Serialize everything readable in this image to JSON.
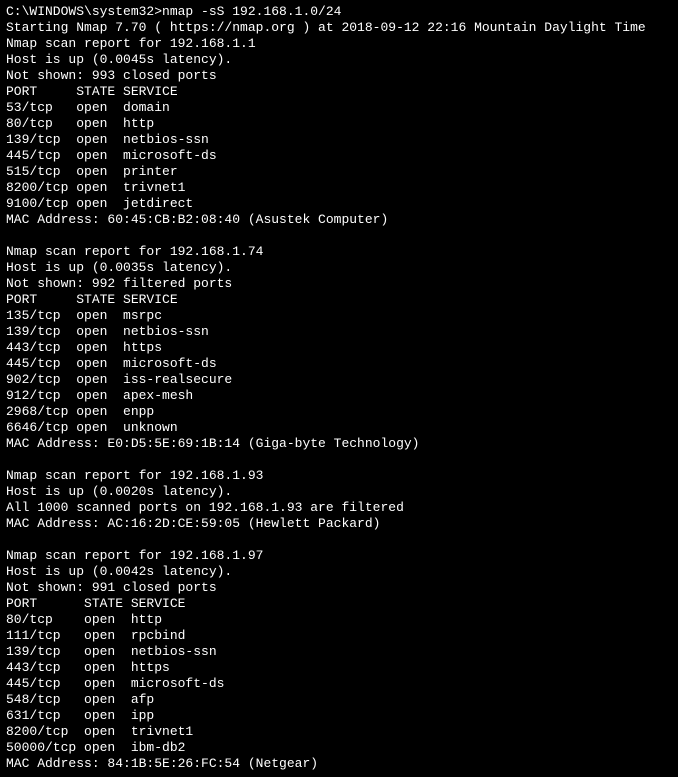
{
  "prompt": "C:\\WINDOWS\\system32>",
  "command": "nmap -sS 192.168.1.0/24",
  "start_line": "Starting Nmap 7.70 ( https://nmap.org ) at 2018-09-12 22:16 Mountain Daylight Time",
  "hosts": [
    {
      "report": "Nmap scan report for 192.168.1.1",
      "status": "Host is up (0.0045s latency).",
      "not_shown": "Not shown: 993 closed ports",
      "header": "PORT     STATE SERVICE",
      "ports": [
        "53/tcp   open  domain",
        "80/tcp   open  http",
        "139/tcp  open  netbios-ssn",
        "445/tcp  open  microsoft-ds",
        "515/tcp  open  printer",
        "8200/tcp open  trivnet1",
        "9100/tcp open  jetdirect"
      ],
      "mac": "MAC Address: 60:45:CB:B2:08:40 (Asustek Computer)"
    },
    {
      "report": "Nmap scan report for 192.168.1.74",
      "status": "Host is up (0.0035s latency).",
      "not_shown": "Not shown: 992 filtered ports",
      "header": "PORT     STATE SERVICE",
      "ports": [
        "135/tcp  open  msrpc",
        "139/tcp  open  netbios-ssn",
        "443/tcp  open  https",
        "445/tcp  open  microsoft-ds",
        "902/tcp  open  iss-realsecure",
        "912/tcp  open  apex-mesh",
        "2968/tcp open  enpp",
        "6646/tcp open  unknown"
      ],
      "mac": "MAC Address: E0:D5:5E:69:1B:14 (Giga-byte Technology)"
    },
    {
      "report": "Nmap scan report for 192.168.1.93",
      "status": "Host is up (0.0020s latency).",
      "not_shown": "All 1000 scanned ports on 192.168.1.93 are filtered",
      "header": "",
      "ports": [],
      "mac": "MAC Address: AC:16:2D:CE:59:05 (Hewlett Packard)"
    },
    {
      "report": "Nmap scan report for 192.168.1.97",
      "status": "Host is up (0.0042s latency).",
      "not_shown": "Not shown: 991 closed ports",
      "header": "PORT      STATE SERVICE",
      "ports": [
        "80/tcp    open  http",
        "111/tcp   open  rpcbind",
        "139/tcp   open  netbios-ssn",
        "443/tcp   open  https",
        "445/tcp   open  microsoft-ds",
        "548/tcp   open  afp",
        "631/tcp   open  ipp",
        "8200/tcp  open  trivnet1",
        "50000/tcp open  ibm-db2"
      ],
      "mac": "MAC Address: 84:1B:5E:26:FC:54 (Netgear)"
    }
  ]
}
